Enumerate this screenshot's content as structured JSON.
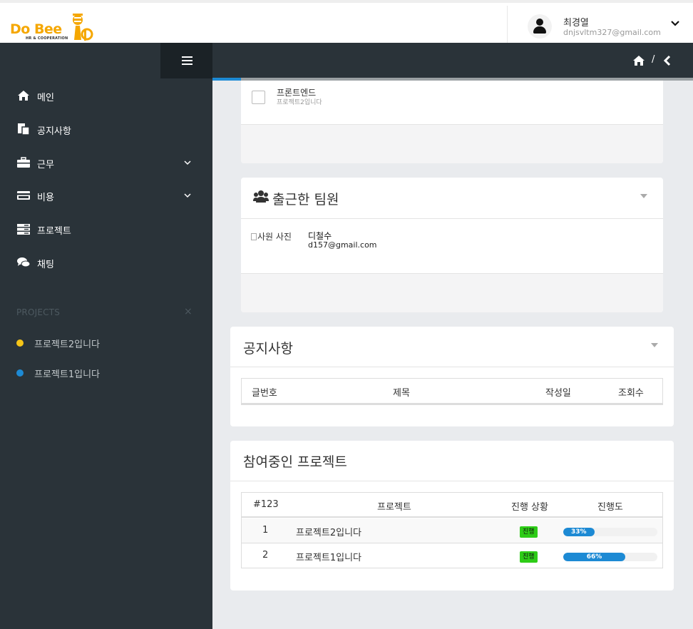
{
  "header": {
    "logo_text": "Do Bee",
    "logo_subtext": "HR & COOPERATION",
    "user_name": "최경열",
    "user_email": "dnjsvltm327@gmail.com"
  },
  "sidebar": {
    "items": [
      {
        "label": "메인",
        "icon": "home-icon"
      },
      {
        "label": "공지사항",
        "icon": "notice-icon"
      },
      {
        "label": "근무",
        "icon": "briefcase-icon",
        "has_submenu": true
      },
      {
        "label": "비용",
        "icon": "credit-card-icon",
        "has_submenu": true
      },
      {
        "label": "프로젝트",
        "icon": "server-icon"
      },
      {
        "label": "채팅",
        "icon": "chat-icon"
      }
    ],
    "projects_title": "PROJECTS",
    "projects_close": "×",
    "projects": [
      {
        "label": "프로젝트2입니다",
        "color": "#f5c518"
      },
      {
        "label": "프로젝트1입니다",
        "color": "#1d8ad4"
      }
    ]
  },
  "breadcrumb": {
    "separator": "/",
    "progress_fraction": 0.06
  },
  "todo": {
    "title": "프론트엔드",
    "subtitle": "프로젝트2입니다"
  },
  "team_panel": {
    "title": "출근한 팀원",
    "members": [
      {
        "img_alt": "사원 사진",
        "name": "디철수",
        "email": "d157@gmail.com"
      }
    ]
  },
  "notice_panel": {
    "title": "공지사항",
    "columns": [
      "글번호",
      "제목",
      "작성일",
      "조회수"
    ]
  },
  "projects_panel": {
    "title": "참여중인 프로젝트",
    "columns": [
      "#123",
      "프로젝트",
      "진행 상황",
      "진행도"
    ],
    "rows": [
      {
        "no": "1",
        "name": "프로젝트2입니다",
        "status": "진행",
        "progress": 33,
        "progress_label": "33%"
      },
      {
        "no": "2",
        "name": "프로젝트1입니다",
        "status": "진행",
        "progress": 66,
        "progress_label": "66%"
      }
    ]
  },
  "colors": {
    "sidebar_bg": "#2a3339",
    "accent_blue": "#1d8ad4",
    "status_green": "#2ecc17",
    "logo_yellow": "#f5a700"
  }
}
